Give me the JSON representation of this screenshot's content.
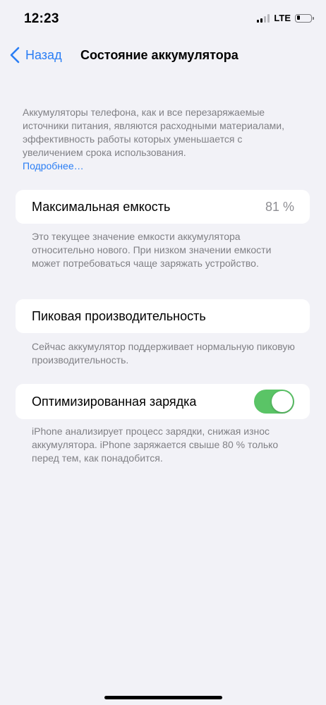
{
  "status_bar": {
    "time": "12:23",
    "network": "LTE"
  },
  "nav": {
    "back_label": "Назад",
    "title": "Состояние аккумулятора"
  },
  "intro": {
    "text": "Аккумуляторы телефона, как и все перезаряжаемые источники питания, являются расходными материалами, эффективность работы которых уменьшается с увеличением срока использования.",
    "link": "Подробнее…"
  },
  "max_capacity": {
    "label": "Максимальная емкость",
    "value": "81 %",
    "footnote": "Это текущее значение емкости аккумулятора относительно нового. При низком значении емкости может потребоваться чаще заряжать устройство."
  },
  "peak_performance": {
    "label": "Пиковая производительность",
    "footnote": "Сейчас аккумулятор поддерживает нормальную пиковую производительность."
  },
  "optimized_charging": {
    "label": "Оптимизированная зарядка",
    "enabled": true,
    "footnote": "iPhone анализирует процесс зарядки, снижая износ аккумулятора. iPhone заряжается свыше 80 % только перед тем, как понадобится."
  },
  "colors": {
    "accent": "#2a7ef5",
    "toggle_on": "#5ac466",
    "background": "#f2f2f7"
  }
}
